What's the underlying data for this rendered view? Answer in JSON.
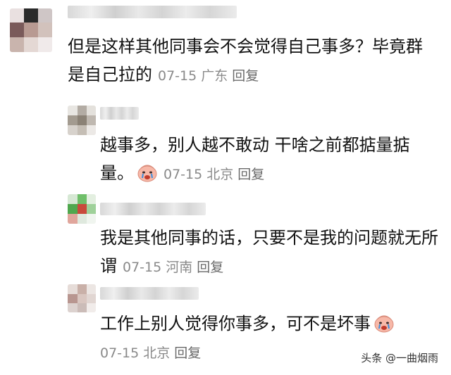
{
  "comments": [
    {
      "text": "但是这样其他同事会不会觉得自己事多？毕竟群是自己拉的",
      "date": "07-15",
      "location": "广东",
      "reply_label": "回复",
      "emoji": ""
    },
    {
      "text": "越事多，别人越不敢动 干啥之前都掂量掂量。",
      "date": "07-15",
      "location": "北京",
      "reply_label": "回复",
      "emoji": "crying-face"
    },
    {
      "text": "我是其他同事的话，只要不是我的问题就无所谓",
      "date": "07-15",
      "location": "河南",
      "reply_label": "回复",
      "emoji": ""
    },
    {
      "text": "工作上别人觉得你事多，可不是坏事",
      "date": "07-15",
      "location": "北京",
      "reply_label": "回复",
      "emoji": "crying-face"
    }
  ],
  "watermark": "头条 @一曲烟雨",
  "colors": {
    "meta": "#8a8a8a",
    "text": "#111111",
    "emoji_face": "#f7b8a8"
  }
}
